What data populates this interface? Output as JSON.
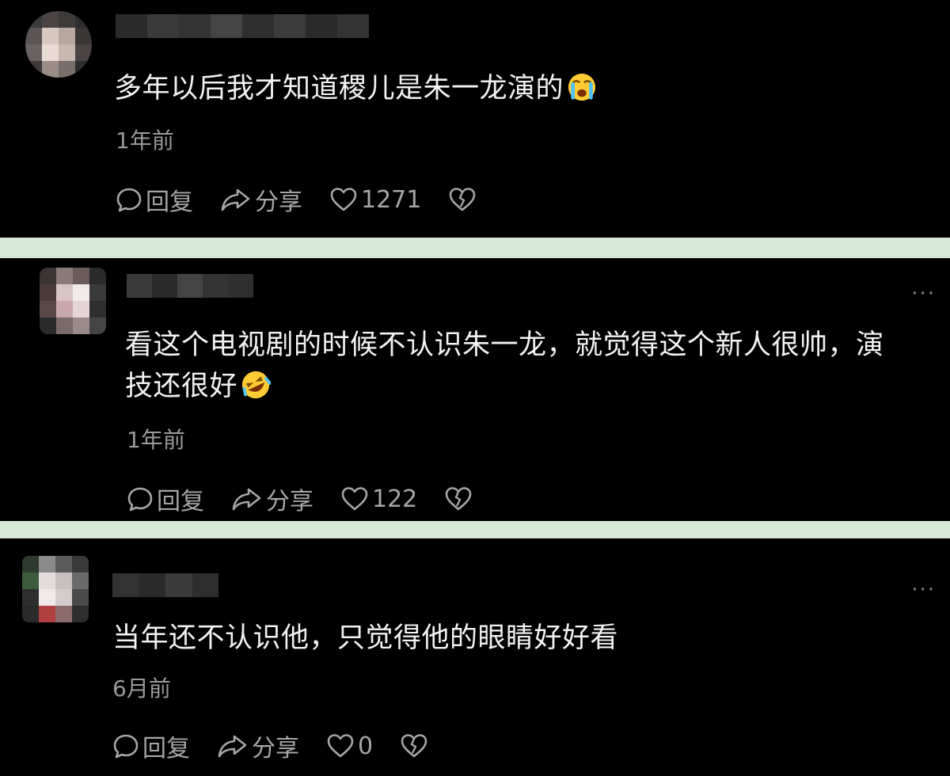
{
  "comments": [
    {
      "text": "多年以后我才知道稷儿是朱一龙演的",
      "emoji": "crying-face-emoji",
      "time": "1年前",
      "reply_label": "回复",
      "share_label": "分享",
      "likes": "1271"
    },
    {
      "text_line1": "看这个电视剧的时候不认识朱一龙，就觉得这个新人很帅，演",
      "text_line2": "技还很好",
      "emoji": "rolling-laughing-emoji",
      "time": "1年前",
      "reply_label": "回复",
      "share_label": "分享",
      "likes": "122",
      "more": "···"
    },
    {
      "text": "当年还不认识他，只觉得他的眼睛好好看",
      "time": "6月前",
      "reply_label": "回复",
      "share_label": "分享",
      "likes": "0",
      "more": "···"
    }
  ],
  "colors": {
    "background": "#000000",
    "divider": "#d6ead7",
    "text": "#f2f2f2",
    "muted": "#9a9a9a"
  }
}
